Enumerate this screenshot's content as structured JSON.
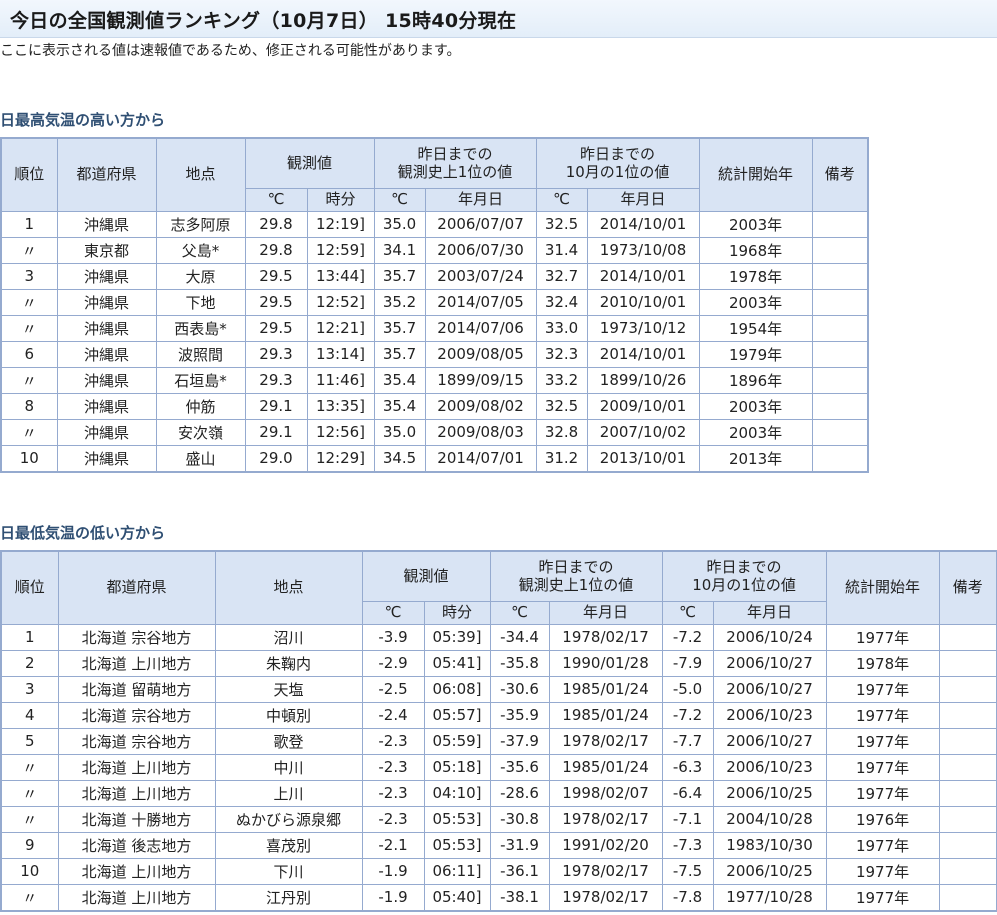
{
  "page": {
    "title": "今日の全国観測値ランキング（10月7日） 15時40分現在",
    "note": "ここに表示される値は速報値であるため、修正される可能性があります。"
  },
  "headers": {
    "rank": "順位",
    "pref": "都道府県",
    "point": "地点",
    "observed": "観測値",
    "record_line1": "昨日までの",
    "record_line2": "観測史上1位の値",
    "month_line1": "昨日までの",
    "month_line2": "10月の1位の値",
    "start_year": "統計開始年",
    "remarks": "備考",
    "celsius": "℃",
    "time": "時分",
    "date": "年月日"
  },
  "high": {
    "title": "日最高気温の高い方から",
    "rows": [
      {
        "rank": "1",
        "pref": "沖縄県",
        "point": "志多阿原",
        "temp": "29.8",
        "time": "12:19]",
        "rec_temp": "35.0",
        "rec_date": "2006/07/07",
        "mon_temp": "32.5",
        "mon_date": "2014/10/01",
        "start": "2003年",
        "remarks": ""
      },
      {
        "rank": "〃",
        "pref": "東京都",
        "point": "父島*",
        "temp": "29.8",
        "time": "12:59]",
        "rec_temp": "34.1",
        "rec_date": "2006/07/30",
        "mon_temp": "31.4",
        "mon_date": "1973/10/08",
        "start": "1968年",
        "remarks": ""
      },
      {
        "rank": "3",
        "pref": "沖縄県",
        "point": "大原",
        "temp": "29.5",
        "time": "13:44]",
        "rec_temp": "35.7",
        "rec_date": "2003/07/24",
        "mon_temp": "32.7",
        "mon_date": "2014/10/01",
        "start": "1978年",
        "remarks": ""
      },
      {
        "rank": "〃",
        "pref": "沖縄県",
        "point": "下地",
        "temp": "29.5",
        "time": "12:52]",
        "rec_temp": "35.2",
        "rec_date": "2014/07/05",
        "mon_temp": "32.4",
        "mon_date": "2010/10/01",
        "start": "2003年",
        "remarks": ""
      },
      {
        "rank": "〃",
        "pref": "沖縄県",
        "point": "西表島*",
        "temp": "29.5",
        "time": "12:21]",
        "rec_temp": "35.7",
        "rec_date": "2014/07/06",
        "mon_temp": "33.0",
        "mon_date": "1973/10/12",
        "start": "1954年",
        "remarks": ""
      },
      {
        "rank": "6",
        "pref": "沖縄県",
        "point": "波照間",
        "temp": "29.3",
        "time": "13:14]",
        "rec_temp": "35.7",
        "rec_date": "2009/08/05",
        "mon_temp": "32.3",
        "mon_date": "2014/10/01",
        "start": "1979年",
        "remarks": ""
      },
      {
        "rank": "〃",
        "pref": "沖縄県",
        "point": "石垣島*",
        "temp": "29.3",
        "time": "11:46]",
        "rec_temp": "35.4",
        "rec_date": "1899/09/15",
        "mon_temp": "33.2",
        "mon_date": "1899/10/26",
        "start": "1896年",
        "remarks": ""
      },
      {
        "rank": "8",
        "pref": "沖縄県",
        "point": "仲筋",
        "temp": "29.1",
        "time": "13:35]",
        "rec_temp": "35.4",
        "rec_date": "2009/08/02",
        "mon_temp": "32.5",
        "mon_date": "2009/10/01",
        "start": "2003年",
        "remarks": ""
      },
      {
        "rank": "〃",
        "pref": "沖縄県",
        "point": "安次嶺",
        "temp": "29.1",
        "time": "12:56]",
        "rec_temp": "35.0",
        "rec_date": "2009/08/03",
        "mon_temp": "32.8",
        "mon_date": "2007/10/02",
        "start": "2003年",
        "remarks": ""
      },
      {
        "rank": "10",
        "pref": "沖縄県",
        "point": "盛山",
        "temp": "29.0",
        "time": "12:29]",
        "rec_temp": "34.5",
        "rec_date": "2014/07/01",
        "mon_temp": "31.2",
        "mon_date": "2013/10/01",
        "start": "2013年",
        "remarks": ""
      }
    ]
  },
  "low": {
    "title": "日最低気温の低い方から",
    "rows": [
      {
        "rank": "1",
        "pref": "北海道 宗谷地方",
        "point": "沼川",
        "temp": "-3.9",
        "time": "05:39]",
        "rec_temp": "-34.4",
        "rec_date": "1978/02/17",
        "mon_temp": "-7.2",
        "mon_date": "2006/10/24",
        "start": "1977年",
        "remarks": ""
      },
      {
        "rank": "2",
        "pref": "北海道 上川地方",
        "point": "朱鞠内",
        "temp": "-2.9",
        "time": "05:41]",
        "rec_temp": "-35.8",
        "rec_date": "1990/01/28",
        "mon_temp": "-7.9",
        "mon_date": "2006/10/27",
        "start": "1978年",
        "remarks": ""
      },
      {
        "rank": "3",
        "pref": "北海道 留萌地方",
        "point": "天塩",
        "temp": "-2.5",
        "time": "06:08]",
        "rec_temp": "-30.6",
        "rec_date": "1985/01/24",
        "mon_temp": "-5.0",
        "mon_date": "2006/10/27",
        "start": "1977年",
        "remarks": ""
      },
      {
        "rank": "4",
        "pref": "北海道 宗谷地方",
        "point": "中頓別",
        "temp": "-2.4",
        "time": "05:57]",
        "rec_temp": "-35.9",
        "rec_date": "1985/01/24",
        "mon_temp": "-7.2",
        "mon_date": "2006/10/23",
        "start": "1977年",
        "remarks": ""
      },
      {
        "rank": "5",
        "pref": "北海道 宗谷地方",
        "point": "歌登",
        "temp": "-2.3",
        "time": "05:59]",
        "rec_temp": "-37.9",
        "rec_date": "1978/02/17",
        "mon_temp": "-7.7",
        "mon_date": "2006/10/27",
        "start": "1977年",
        "remarks": ""
      },
      {
        "rank": "〃",
        "pref": "北海道 上川地方",
        "point": "中川",
        "temp": "-2.3",
        "time": "05:18]",
        "rec_temp": "-35.6",
        "rec_date": "1985/01/24",
        "mon_temp": "-6.3",
        "mon_date": "2006/10/23",
        "start": "1977年",
        "remarks": ""
      },
      {
        "rank": "〃",
        "pref": "北海道 上川地方",
        "point": "上川",
        "temp": "-2.3",
        "time": "04:10]",
        "rec_temp": "-28.6",
        "rec_date": "1998/02/07",
        "mon_temp": "-6.4",
        "mon_date": "2006/10/25",
        "start": "1977年",
        "remarks": ""
      },
      {
        "rank": "〃",
        "pref": "北海道 十勝地方",
        "point": "ぬかびら源泉郷",
        "temp": "-2.3",
        "time": "05:53]",
        "rec_temp": "-30.8",
        "rec_date": "1978/02/17",
        "mon_temp": "-7.1",
        "mon_date": "2004/10/28",
        "start": "1976年",
        "remarks": ""
      },
      {
        "rank": "9",
        "pref": "北海道 後志地方",
        "point": "喜茂別",
        "temp": "-2.1",
        "time": "05:53]",
        "rec_temp": "-31.9",
        "rec_date": "1991/02/20",
        "mon_temp": "-7.3",
        "mon_date": "1983/10/30",
        "start": "1977年",
        "remarks": ""
      },
      {
        "rank": "10",
        "pref": "北海道 上川地方",
        "point": "下川",
        "temp": "-1.9",
        "time": "06:11]",
        "rec_temp": "-36.1",
        "rec_date": "1978/02/17",
        "mon_temp": "-7.5",
        "mon_date": "2006/10/25",
        "start": "1977年",
        "remarks": ""
      },
      {
        "rank": "〃",
        "pref": "北海道 上川地方",
        "point": "江丹別",
        "temp": "-1.9",
        "time": "05:40]",
        "rec_temp": "-38.1",
        "rec_date": "1978/02/17",
        "mon_temp": "-7.8",
        "mon_date": "1977/10/28",
        "start": "1977年",
        "remarks": ""
      }
    ]
  }
}
